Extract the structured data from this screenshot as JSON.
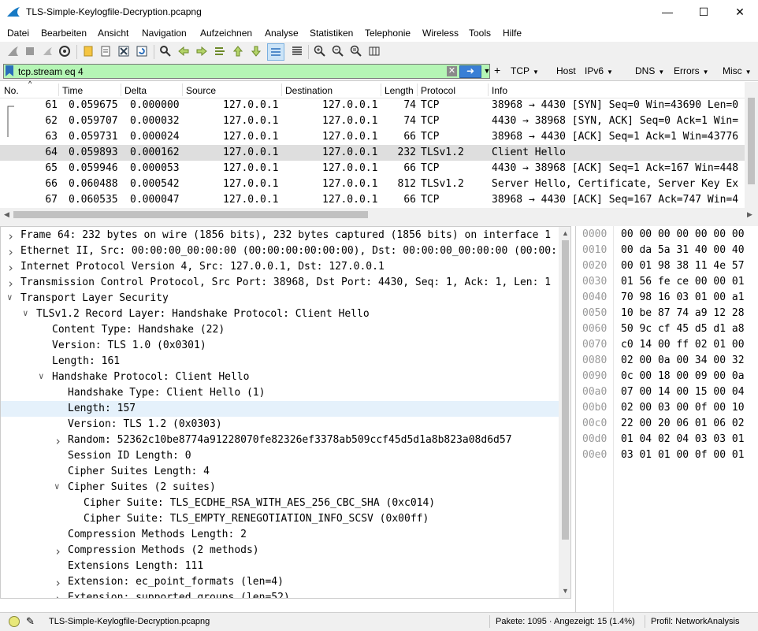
{
  "window": {
    "title": "TLS-Simple-Keylogfile-Decryption.pcapng"
  },
  "menu": [
    "Datei",
    "Bearbeiten",
    "Ansicht",
    "Navigation",
    "Aufzeichnen",
    "Analyse",
    "Statistiken",
    "Telephonie",
    "Wireless",
    "Tools",
    "Hilfe"
  ],
  "filter": {
    "value": "tcp.stream eq 4",
    "buttons": [
      "TCP",
      "Host",
      "IPv6",
      "DNS",
      "Errors",
      "Misc"
    ]
  },
  "packet_list": {
    "columns": [
      "No.",
      "Time",
      "Delta",
      "Source",
      "Destination",
      "Length",
      "Protocol",
      "Info"
    ],
    "rows": [
      {
        "no": "61",
        "time": "0.059675",
        "delta": "0.000000",
        "src": "127.0.0.1",
        "dst": "127.0.0.1",
        "len": "74",
        "proto": "TCP",
        "info": "38968 → 4430 [SYN] Seq=0 Win=43690 Len=0"
      },
      {
        "no": "62",
        "time": "0.059707",
        "delta": "0.000032",
        "src": "127.0.0.1",
        "dst": "127.0.0.1",
        "len": "74",
        "proto": "TCP",
        "info": "4430 → 38968 [SYN, ACK] Seq=0 Ack=1 Win="
      },
      {
        "no": "63",
        "time": "0.059731",
        "delta": "0.000024",
        "src": "127.0.0.1",
        "dst": "127.0.0.1",
        "len": "66",
        "proto": "TCP",
        "info": "38968 → 4430 [ACK] Seq=1 Ack=1 Win=43776"
      },
      {
        "no": "64",
        "time": "0.059893",
        "delta": "0.000162",
        "src": "127.0.0.1",
        "dst": "127.0.0.1",
        "len": "232",
        "proto": "TLSv1.2",
        "info": "Client Hello"
      },
      {
        "no": "65",
        "time": "0.059946",
        "delta": "0.000053",
        "src": "127.0.0.1",
        "dst": "127.0.0.1",
        "len": "66",
        "proto": "TCP",
        "info": "4430 → 38968 [ACK] Seq=1 Ack=167 Win=448"
      },
      {
        "no": "66",
        "time": "0.060488",
        "delta": "0.000542",
        "src": "127.0.0.1",
        "dst": "127.0.0.1",
        "len": "812",
        "proto": "TLSv1.2",
        "info": "Server Hello, Certificate, Server Key Ex"
      },
      {
        "no": "67",
        "time": "0.060535",
        "delta": "0.000047",
        "src": "127.0.0.1",
        "dst": "127.0.0.1",
        "len": "66",
        "proto": "TCP",
        "info": "38968 → 4430 [ACK] Seq=167 Ack=747 Win=4"
      }
    ]
  },
  "details": [
    {
      "toggle": ">",
      "text": "Frame 64: 232 bytes on wire (1856 bits), 232 bytes captured (1856 bits) on interface 1"
    },
    {
      "toggle": ">",
      "text": "Ethernet II, Src: 00:00:00_00:00:00 (00:00:00:00:00:00), Dst: 00:00:00_00:00:00 (00:00:"
    },
    {
      "toggle": ">",
      "text": "Internet Protocol Version 4, Src: 127.0.0.1, Dst: 127.0.0.1"
    },
    {
      "toggle": ">",
      "text": "Transmission Control Protocol, Src Port: 38968, Dst Port: 4430, Seq: 1, Ack: 1, Len: 1"
    },
    {
      "toggle": "v",
      "text": "Transport Layer Security"
    },
    {
      "toggle": "v",
      "text": "TLSv1.2 Record Layer: Handshake Protocol: Client Hello"
    },
    {
      "toggle": "",
      "text": "Content Type: Handshake (22)"
    },
    {
      "toggle": "",
      "text": "Version: TLS 1.0 (0x0301)"
    },
    {
      "toggle": "",
      "text": "Length: 161"
    },
    {
      "toggle": "v",
      "text": "Handshake Protocol: Client Hello"
    },
    {
      "toggle": "",
      "text": "Handshake Type: Client Hello (1)"
    },
    {
      "toggle": "",
      "text": "Length: 157"
    },
    {
      "toggle": "",
      "text": "Version: TLS 1.2 (0x0303)"
    },
    {
      "toggle": ">",
      "text": "Random: 52362c10be8774a91228070fe82326ef3378ab509ccf45d5d1a8b823a08d6d57"
    },
    {
      "toggle": "",
      "text": "Session ID Length: 0"
    },
    {
      "toggle": "",
      "text": "Cipher Suites Length: 4"
    },
    {
      "toggle": "v",
      "text": "Cipher Suites (2 suites)"
    },
    {
      "toggle": "",
      "text": "Cipher Suite: TLS_ECDHE_RSA_WITH_AES_256_CBC_SHA (0xc014)"
    },
    {
      "toggle": "",
      "text": "Cipher Suite: TLS_EMPTY_RENEGOTIATION_INFO_SCSV (0x00ff)"
    },
    {
      "toggle": "",
      "text": "Compression Methods Length: 2"
    },
    {
      "toggle": ">",
      "text": "Compression Methods (2 methods)"
    },
    {
      "toggle": "",
      "text": "Extensions Length: 111"
    },
    {
      "toggle": ">",
      "text": "Extension: ec_point_formats (len=4)"
    },
    {
      "toggle": ">",
      "text": "Extension: supported_groups (len=52)"
    }
  ],
  "hex": [
    {
      "off": "0000",
      "bytes": "00 00 00 00 00 00 00"
    },
    {
      "off": "0010",
      "bytes": "00 da 5a 31 40 00 40"
    },
    {
      "off": "0020",
      "bytes": "00 01 98 38 11 4e 57"
    },
    {
      "off": "0030",
      "bytes": "01 56 fe ce 00 00 01"
    },
    {
      "off": "0040",
      "bytes": "70 98 16 03 01 00 a1"
    },
    {
      "off": "0050",
      "bytes": "10 be 87 74 a9 12 28"
    },
    {
      "off": "0060",
      "bytes": "50 9c cf 45 d5 d1 a8"
    },
    {
      "off": "0070",
      "bytes": "c0 14 00 ff 02 01 00"
    },
    {
      "off": "0080",
      "bytes": "02 00 0a 00 34 00 32"
    },
    {
      "off": "0090",
      "bytes": "0c 00 18 00 09 00 0a"
    },
    {
      "off": "00a0",
      "bytes": "07 00 14 00 15 00 04"
    },
    {
      "off": "00b0",
      "bytes": "02 00 03 00 0f 00 10"
    },
    {
      "off": "00c0",
      "bytes": "22 00 20 06 01 06 02"
    },
    {
      "off": "00d0",
      "bytes": "01 04 02 04 03 03 01"
    },
    {
      "off": "00e0",
      "bytes": "03 01 01 00 0f 00 01"
    }
  ],
  "status": {
    "file": "TLS-Simple-Keylogfile-Decryption.pcapng",
    "packets": "Pakete: 1095 · Angezeigt: 15 (1.4%)",
    "profile": "Profil: NetworkAnalysis"
  },
  "colors": {
    "filter_valid": "#b5f5b5",
    "selected_row": "#dedede",
    "selected_detail": "#e5f1fb"
  }
}
